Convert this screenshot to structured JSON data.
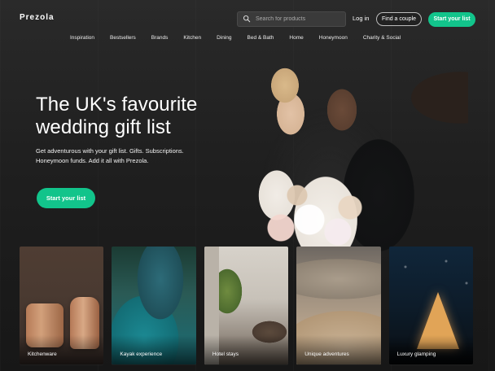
{
  "brand": {
    "name": "Prezola",
    "accent": "#12c48b"
  },
  "header": {
    "search_placeholder": "Search for products",
    "login_label": "Log in",
    "find_couple_label": "Find a couple",
    "start_list_label": "Start your list",
    "icons": {
      "search": "search-icon"
    }
  },
  "nav": {
    "items": [
      "Inspiration",
      "Bestsellers",
      "Brands",
      "Kitchen",
      "Dining",
      "Bed & Bath",
      "Home",
      "Honeymoon",
      "Charity & Social"
    ]
  },
  "hero": {
    "title_line1": "The UK's favourite",
    "title_line2": "wedding gift list",
    "subtitle": "Get adventurous with your gift list. Gifts. Subscriptions. Honeymoon funds. Add it all with Prezola.",
    "cta_label": "Start your list"
  },
  "cards": [
    {
      "label": "Kitchenware"
    },
    {
      "label": "Kayak experience"
    },
    {
      "label": "Hotel stays"
    },
    {
      "label": "Unique adventures"
    },
    {
      "label": "Luxury glamping"
    }
  ]
}
